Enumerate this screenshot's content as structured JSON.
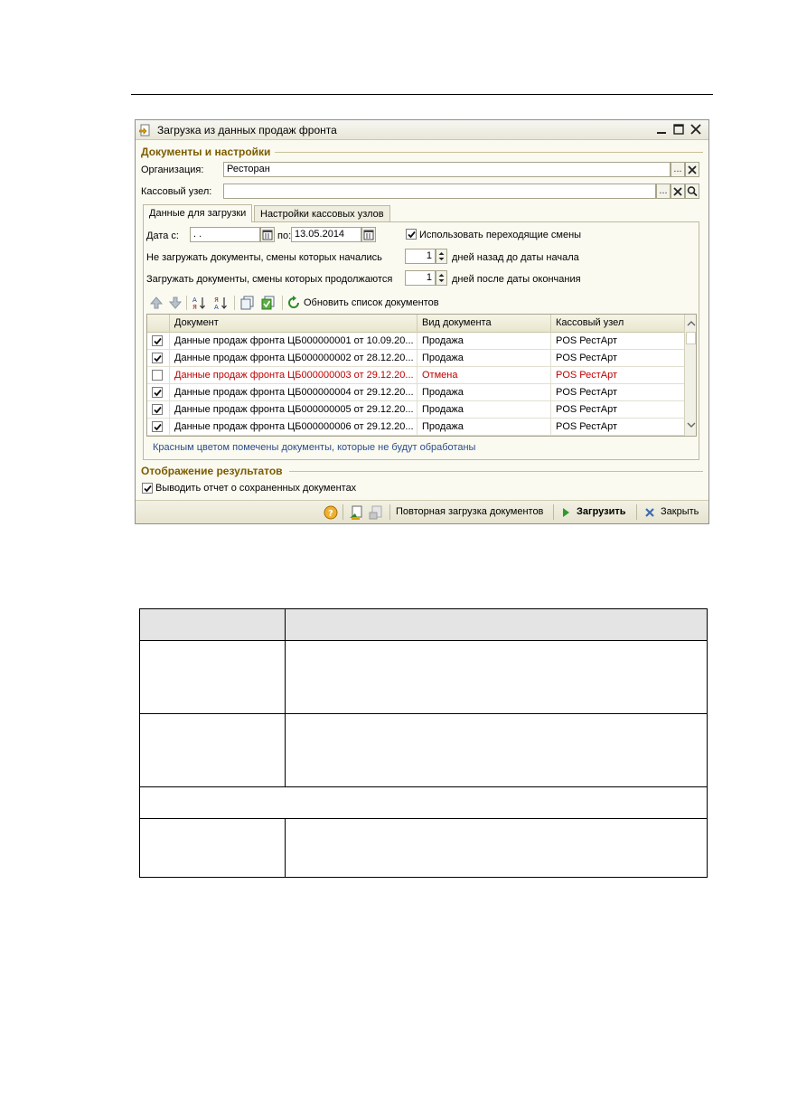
{
  "window": {
    "title": "Загрузка из данных продаж фронта"
  },
  "sections": {
    "docs_settings": "Документы и настройки",
    "results": "Отображение результатов"
  },
  "org": {
    "label": "Организация:",
    "value": "Ресторан"
  },
  "cash_node": {
    "label": "Кассовый узел:",
    "value": ""
  },
  "select_button": "...",
  "tabs": [
    {
      "label": "Данные для загрузки",
      "active": true
    },
    {
      "label": "Настройки кассовых узлов",
      "active": false
    }
  ],
  "date": {
    "from_label": "Дата с:",
    "from_value": " .  .",
    "to_label": "по:",
    "to_value": "13.05.2014"
  },
  "use_overlapping": {
    "label": "Использовать переходящие смены",
    "checked": true
  },
  "skip_started": {
    "label": "Не загружать документы, смены которых начались",
    "value": "1",
    "suffix": "дней назад до даты начала"
  },
  "load_continuing": {
    "label": "Загружать документы, смены которых продолжаются",
    "value": "1",
    "suffix": "дней после даты окончания"
  },
  "toolbar": {
    "refresh_label": "Обновить список документов"
  },
  "grid": {
    "columns": [
      "Документ",
      "Вид документа",
      "Кассовый узел"
    ],
    "rows": [
      {
        "checked": true,
        "doc": "Данные продаж фронта ЦБ000000001 от 10.09.20...",
        "kind": "Продажа",
        "node": "POS РестАрт",
        "red": false
      },
      {
        "checked": true,
        "doc": "Данные продаж фронта ЦБ000000002 от 28.12.20...",
        "kind": "Продажа",
        "node": "POS РестАрт",
        "red": false
      },
      {
        "checked": false,
        "doc": "Данные продаж фронта ЦБ000000003 от 29.12.20...",
        "kind": "Отмена",
        "node": "POS РестАрт",
        "red": true
      },
      {
        "checked": true,
        "doc": "Данные продаж фронта ЦБ000000004 от 29.12.20...",
        "kind": "Продажа",
        "node": "POS РестАрт",
        "red": false
      },
      {
        "checked": true,
        "doc": "Данные продаж фронта ЦБ000000005 от 29.12.20...",
        "kind": "Продажа",
        "node": "POS РестАрт",
        "red": false
      },
      {
        "checked": true,
        "doc": "Данные продаж фронта ЦБ000000006 от 29.12.20...",
        "kind": "Продажа",
        "node": "POS РестАрт",
        "red": false
      }
    ]
  },
  "note": "Красным цветом помечены документы, которые не будут обработаны",
  "report_checkbox": {
    "label": "Выводить отчет о сохраненных документах",
    "checked": true
  },
  "bottom": {
    "reload_label": "Повторная загрузка документов",
    "load_label": "Загрузить",
    "close_label": "Закрыть"
  },
  "colors": {
    "section_title": "#7c5c00",
    "error_row": "#c00000",
    "note": "#2b4d8c"
  }
}
